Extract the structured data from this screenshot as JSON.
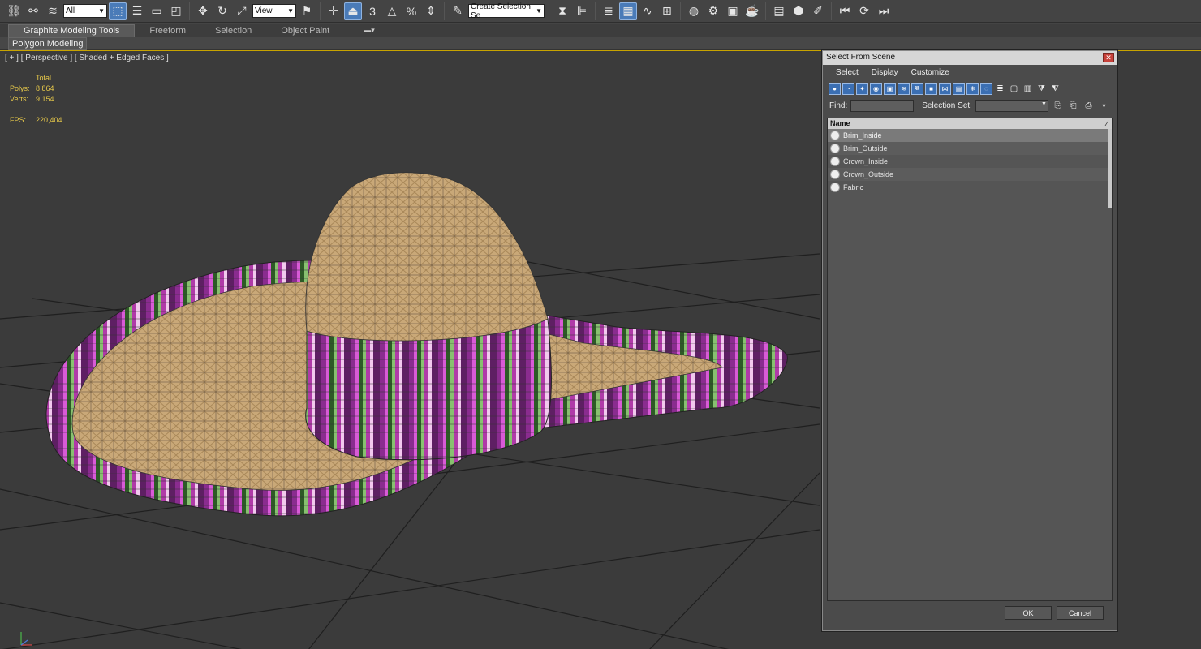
{
  "toolbar": {
    "filter_value": "All",
    "refcoord_value": "View",
    "selection_set_value": "Create Selection Se",
    "snap_label": "3",
    "percent_label": "%"
  },
  "ribbon": {
    "tabs": [
      "Graphite Modeling Tools",
      "Freeform",
      "Selection",
      "Object Paint"
    ],
    "active_tab": "Graphite Modeling Tools",
    "sub_tab": "Polygon Modeling"
  },
  "viewport": {
    "label": "[ + ] [ Perspective ] [ Shaded + Edged Faces ]",
    "stats": {
      "header": "Total",
      "polys_label": "Polys:",
      "polys_value": "8 864",
      "verts_label": "Verts:",
      "verts_value": "9 154",
      "fps_label": "FPS:",
      "fps_value": "220,404"
    }
  },
  "dialog": {
    "title": "Select From Scene",
    "menu": [
      "Select",
      "Display",
      "Customize"
    ],
    "find_label": "Find:",
    "find_value": "",
    "selection_set_label": "Selection Set:",
    "column_name": "Name",
    "objects": [
      "Brim_Inside",
      "Brim_Outside",
      "Crown_Inside",
      "Crown_Outside",
      "Fabric"
    ],
    "selected_object": "Brim_Inside",
    "ok_label": "OK",
    "cancel_label": "Cancel"
  },
  "colors": {
    "accent_blue": "#3b6fb3",
    "stats_yellow": "#e6c84a",
    "viewport_border": "#c8a400",
    "background": "#3b3b3b"
  }
}
